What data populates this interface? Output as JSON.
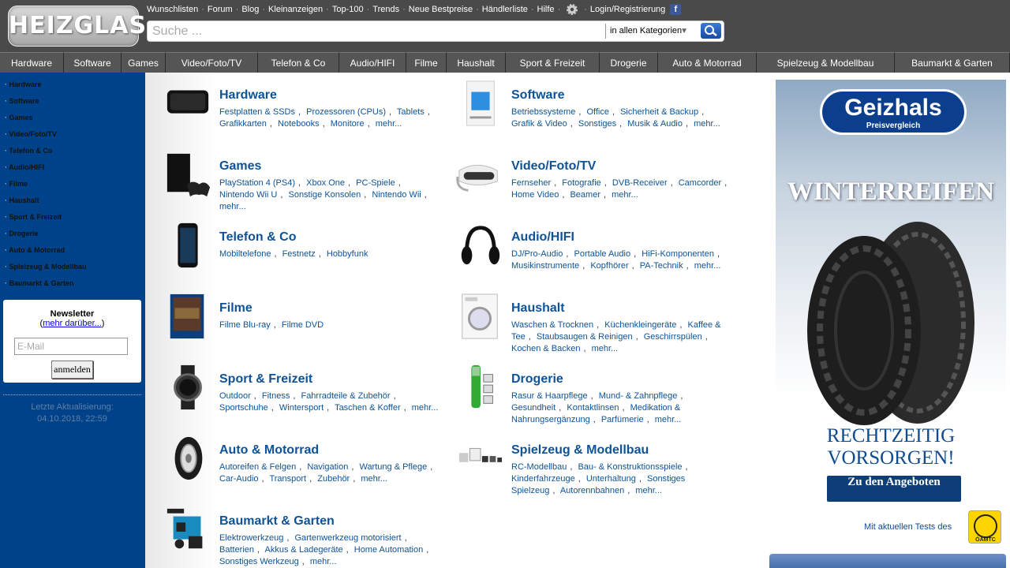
{
  "header": {
    "logo_text": "HEIZGLAS",
    "toplinks": [
      "Wunschlisten",
      "Forum",
      "Blog",
      "Kleinanzeigen",
      "Top-100",
      "Trends",
      "Neue Bestpreise",
      "Händlerliste",
      "Hilfe"
    ],
    "login": "Login/Registrierung",
    "search_placeholder": "Suche ...",
    "category_select": "in allen Kategorien"
  },
  "nav": [
    {
      "label": "Hardware",
      "w": 81
    },
    {
      "label": "Software",
      "w": 73
    },
    {
      "label": "Games",
      "w": 56
    },
    {
      "label": "Video/Foto/TV",
      "w": 117
    },
    {
      "label": "Telefon & Co",
      "w": 103
    },
    {
      "label": "Audio/HIFI",
      "w": 85
    },
    {
      "label": "Filme",
      "w": 51
    },
    {
      "label": "Haushalt",
      "w": 75
    },
    {
      "label": "Sport & Freizeit",
      "w": 119
    },
    {
      "label": "Drogerie",
      "w": 74
    },
    {
      "label": "Auto & Motorrad",
      "w": 125
    },
    {
      "label": "Spielzeug & Modellbau",
      "w": 175
    },
    {
      "label": "Baumarkt & Garten",
      "w": 146
    }
  ],
  "sidebar": {
    "items": [
      "Hardware",
      "Software",
      "Games",
      "Video/Foto/TV",
      "Telefon & Co",
      "Audio/HIFI",
      "Filme",
      "Haushalt",
      "Sport & Freizeit",
      "Drogerie",
      "Auto & Motorrad",
      "Spielzeug & Modellbau",
      "Baumarkt & Garten"
    ],
    "newsletter_title": "Newsletter",
    "newsletter_more": "mehr darüber...",
    "email_placeholder": "E-Mail",
    "subscribe": "anmelden",
    "update_label": "Letzte Aktualisierung:",
    "update_time": "04.10.2018, 22:59"
  },
  "categories": [
    {
      "title": "Hardware",
      "subs": [
        "Festplatten & SSDs",
        "Prozessoren (CPUs)",
        "Tablets",
        "Grafikkarten",
        "Notebooks",
        "Monitore",
        "mehr..."
      ]
    },
    {
      "title": "Software",
      "subs": [
        "Betriebssysteme",
        "Office",
        "Sicherheit & Backup",
        "Grafik & Video",
        "Sonstiges",
        "Musik & Audio",
        "mehr..."
      ]
    },
    {
      "title": "Games",
      "subs": [
        "PlayStation 4 (PS4)",
        "Xbox One",
        "PC-Spiele",
        "Nintendo Wii U",
        "Sonstige Konsolen",
        "Nintendo Wii",
        "mehr..."
      ]
    },
    {
      "title": "Video/Foto/TV",
      "subs": [
        "Fernseher",
        "Fotografie",
        "DVB-Receiver",
        "Camcorder",
        "Home Video",
        "Beamer",
        "mehr..."
      ]
    },
    {
      "title": "Telefon & Co",
      "subs": [
        "Mobiltelefone",
        "Festnetz",
        "Hobbyfunk"
      ]
    },
    {
      "title": "Audio/HIFI",
      "subs": [
        "DJ/Pro-Audio",
        "Portable Audio",
        "HiFi-Komponenten",
        "Musikinstrumente",
        "Kopfhörer",
        "PA-Technik",
        "mehr..."
      ]
    },
    {
      "title": "Filme",
      "subs": [
        "Filme Blu-ray",
        "Filme DVD"
      ]
    },
    {
      "title": "Haushalt",
      "subs": [
        "Waschen & Trocknen",
        "Küchenkleingeräte",
        "Kaffee & Tee",
        "Staubsaugen & Reinigen",
        "Geschirrspülen",
        "Kochen & Backen",
        "mehr..."
      ]
    },
    {
      "title": "Sport & Freizeit",
      "subs": [
        "Outdoor",
        "Fitness",
        "Fahrradteile & Zubehör",
        "Sportschuhe",
        "Wintersport",
        "Taschen & Koffer",
        "mehr..."
      ]
    },
    {
      "title": "Drogerie",
      "subs": [
        "Rasur & Haarpflege",
        "Mund- & Zahnpflege",
        "Gesundheit",
        "Kontaktlinsen",
        "Medikation & Nahrungsergänzung",
        "Parfümerie",
        "mehr..."
      ]
    },
    {
      "title": "Auto & Motorrad",
      "subs": [
        "Autoreifen & Felgen",
        "Navigation",
        "Wartung & Pflege",
        "Car-Audio",
        "Transport",
        "Zubehör",
        "mehr..."
      ]
    },
    {
      "title": "Spielzeug & Modellbau",
      "subs": [
        "RC-Modellbau",
        "Bau- & Konstruktionsspiele",
        "Kinderfahrzeuge",
        "Unterhaltung",
        "Sonstiges Spielzeug",
        "Autorennbahnen",
        "mehr..."
      ]
    },
    {
      "title": "Baumarkt & Garten",
      "subs": [
        "Elektrowerkzeug",
        "Gartenwerkzeug motorisiert",
        "Batterien",
        "Akkus & Ladegeräte",
        "Home Automation",
        "Sonstiges Werkzeug",
        "mehr..."
      ]
    }
  ],
  "ad": {
    "logo": "Geizhals",
    "logo_sub": "Preisvergleich",
    "headline": "WINTERREIFEN",
    "sub_line1": "RECHTZEITIG",
    "sub_line2": "VORSORGEN!",
    "button": "Zu den Angeboten",
    "tests": "Mit aktuellen Tests des",
    "badge": "ÖAMTC"
  }
}
